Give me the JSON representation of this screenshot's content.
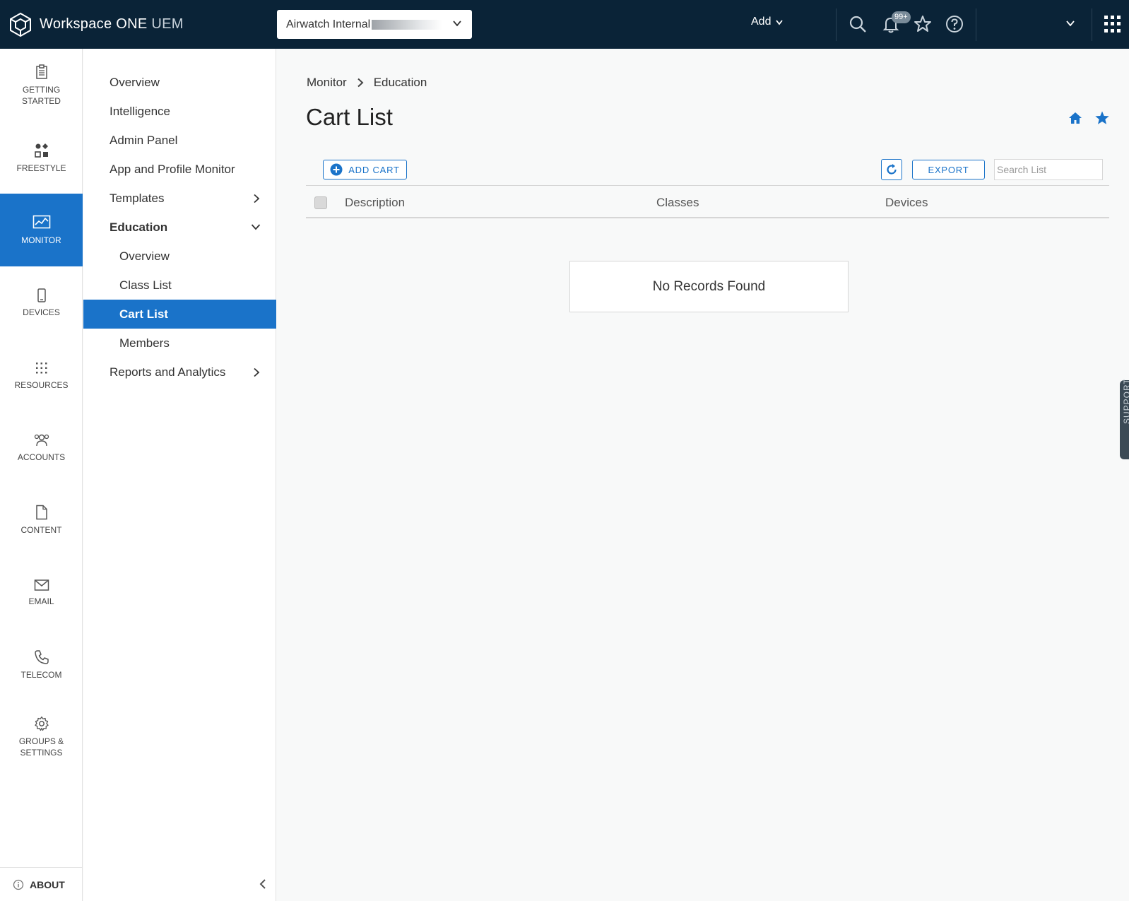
{
  "app": {
    "brand_main": "Workspace ONE",
    "brand_suffix": "UEM"
  },
  "topbar": {
    "org_value": "Airwatch Internal",
    "add_label": "Add",
    "notification_badge": "99+",
    "icons": [
      "search-icon",
      "bell-icon",
      "star-icon",
      "help-icon",
      "apps-grid-icon"
    ]
  },
  "rail": {
    "items": [
      {
        "label": "GETTING STARTED",
        "icon": "clipboard-icon"
      },
      {
        "label": "FREESTYLE",
        "icon": "freestyle-icon"
      },
      {
        "label": "MONITOR",
        "icon": "monitor-chart-icon",
        "active": true
      },
      {
        "label": "DEVICES",
        "icon": "phone-icon"
      },
      {
        "label": "RESOURCES",
        "icon": "grid-dots-icon"
      },
      {
        "label": "ACCOUNTS",
        "icon": "users-icon"
      },
      {
        "label": "CONTENT",
        "icon": "file-icon"
      },
      {
        "label": "EMAIL",
        "icon": "envelope-icon"
      },
      {
        "label": "TELECOM",
        "icon": "phone-handset-icon"
      },
      {
        "label": "GROUPS & SETTINGS",
        "icon": "gear-icon"
      }
    ],
    "about_label": "ABOUT"
  },
  "subnav": {
    "items": [
      {
        "label": "Overview"
      },
      {
        "label": "Intelligence"
      },
      {
        "label": "Admin Panel"
      },
      {
        "label": "App and Profile Monitor"
      },
      {
        "label": "Templates"
      },
      {
        "label": "Education"
      },
      {
        "label": "Overview"
      },
      {
        "label": "Class List"
      },
      {
        "label": "Cart List",
        "active": true
      },
      {
        "label": "Members"
      },
      {
        "label": "Reports and Analytics"
      }
    ]
  },
  "main": {
    "breadcrumb": [
      "Monitor",
      "Education"
    ],
    "title": "Cart List",
    "add_cart_label": "ADD CART",
    "export_label": "EXPORT",
    "search_placeholder": "Search List",
    "columns": [
      "Description",
      "Classes",
      "Devices"
    ],
    "empty_message": "No Records Found",
    "support_label": "SUPPORT"
  },
  "colors": {
    "topbar": "#0a2337",
    "accent": "#1a73c9"
  }
}
